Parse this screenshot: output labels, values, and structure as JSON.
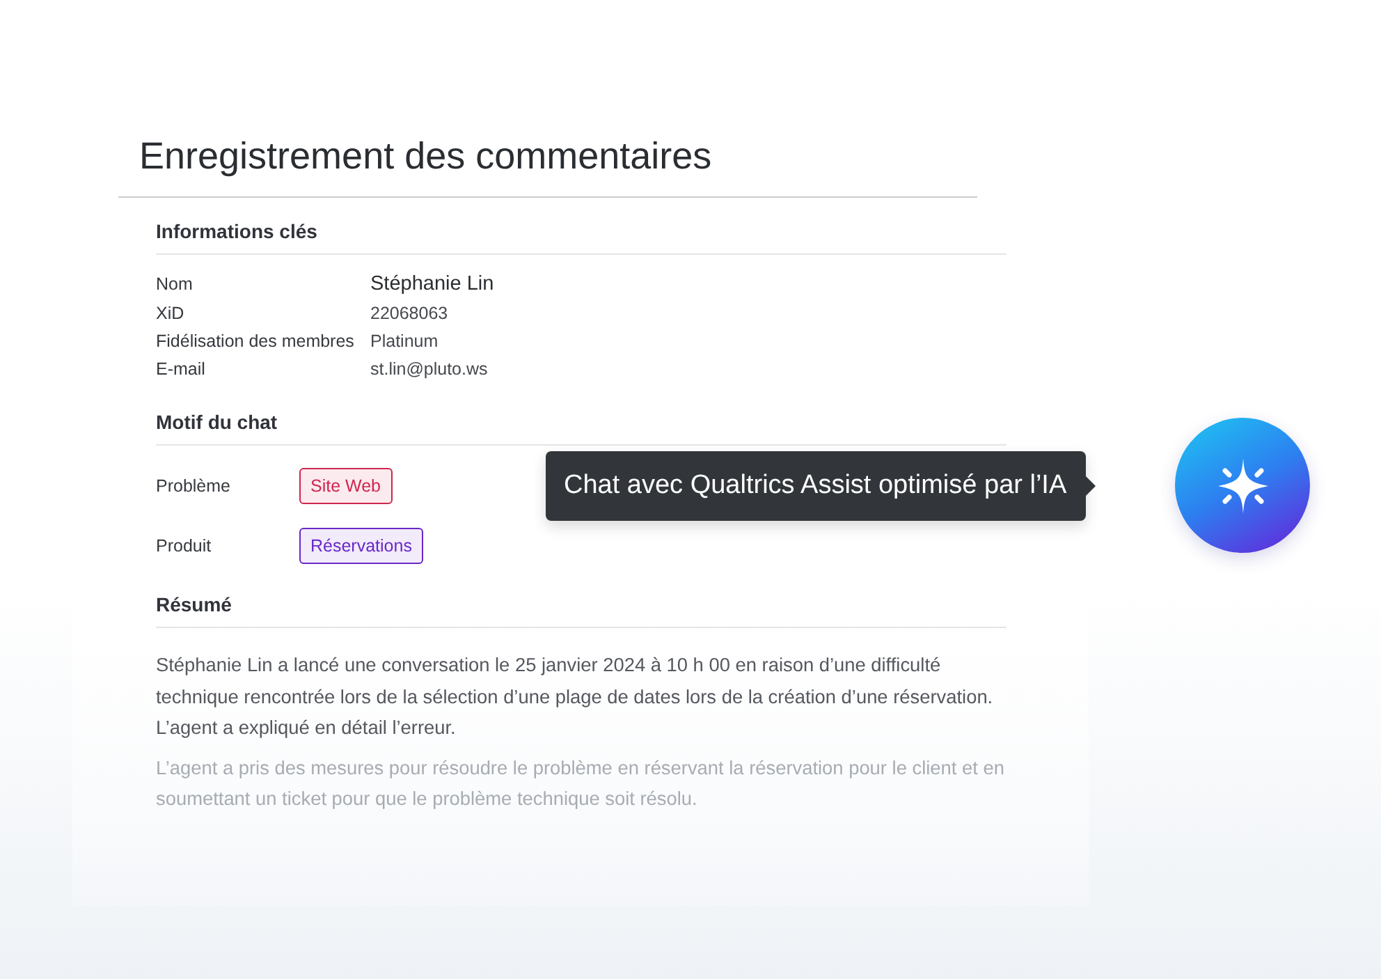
{
  "title": "Enregistrement des commentaires",
  "key_info": {
    "heading": "Informations clés",
    "fields": [
      {
        "label": "Nom",
        "value": "Stéphanie Lin",
        "kind": "name"
      },
      {
        "label": "XiD",
        "value": "22068063",
        "kind": "plain"
      },
      {
        "label": "Fidélisation des membres",
        "value": "Platinum",
        "kind": "plain"
      },
      {
        "label": "E-mail",
        "value": "st.lin@pluto.ws",
        "kind": "plain"
      }
    ]
  },
  "chat_reason": {
    "heading": "Motif du chat",
    "fields": [
      {
        "label": "Problème",
        "tag": "Site Web",
        "color": "#d0254f"
      },
      {
        "label": "Produit",
        "tag": "Réservations",
        "color": "#6a27c9"
      }
    ]
  },
  "summary": {
    "heading": "Résumé",
    "paragraphs": [
      {
        "text": "Stéphanie Lin a lancé une conversation le 25 janvier 2024 à 10 h 00 en raison d’une difficulté technique rencontrée lors de la sélection d’une plage de dates lors de la création d’une réservation. L’agent a expliqué en détail l’erreur.",
        "faded": false
      },
      {
        "text": "L’agent a pris des mesures pour résoudre le problème en réservant la réservation pour le client et en soumettant un ticket pour que le problème technique soit résolu.",
        "faded": true
      }
    ]
  },
  "assistant": {
    "tooltip": "Chat avec Qualtrics Assist optimisé par l’IA"
  }
}
